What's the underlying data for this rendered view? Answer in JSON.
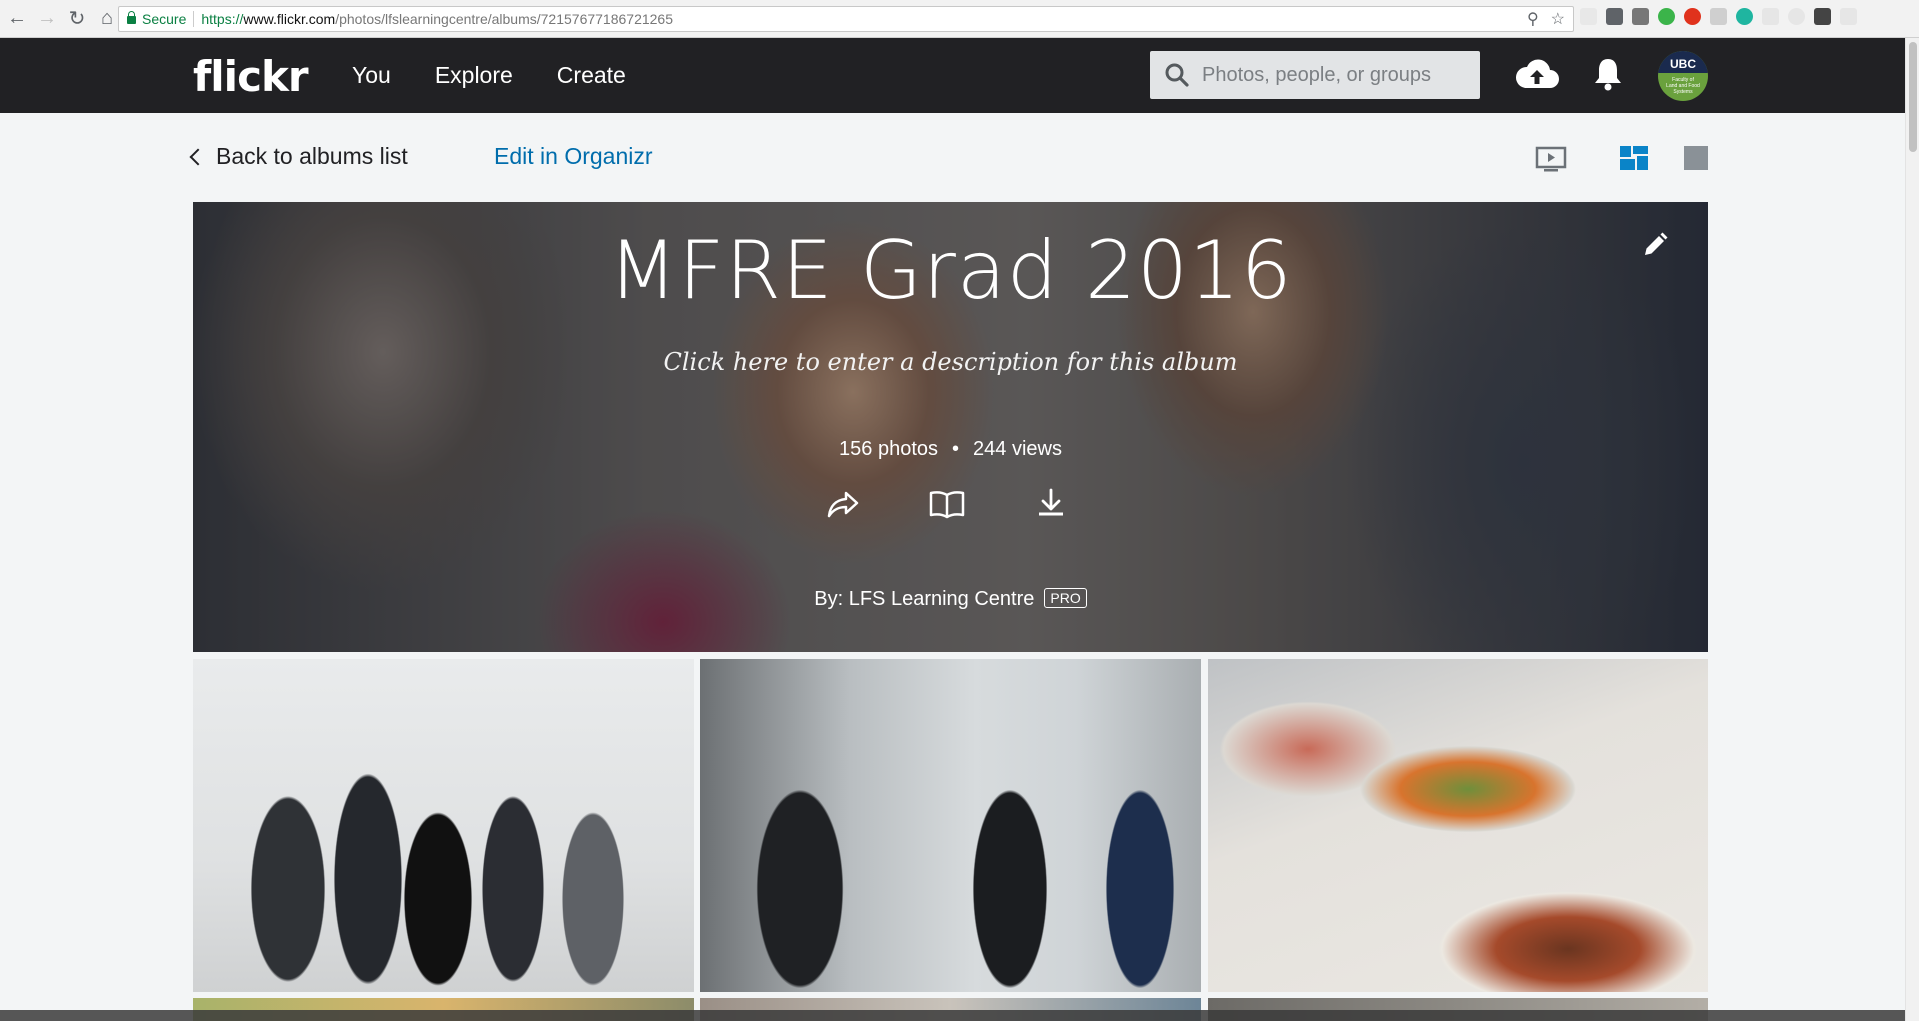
{
  "browser": {
    "secure_label": "Secure",
    "url_scheme": "https://",
    "url_host": "www.flickr.com",
    "url_path": "/photos/lfslearningcentre/albums/72157677186721265"
  },
  "header": {
    "logo": "flickr",
    "nav": [
      "You",
      "Explore",
      "Create"
    ],
    "search_placeholder": "Photos, people, or groups",
    "avatar_text": "UBC",
    "avatar_subtext": "Faculty of Land and Food Systems"
  },
  "subnav": {
    "back_label": "Back to albums list",
    "edit_label": "Edit in Organizr"
  },
  "album": {
    "title": "MFRE Grad 2016",
    "description_placeholder": "Click here to enter a description for this album",
    "photos": "156 photos",
    "views": "244 views",
    "separator": "•",
    "owner": "By: LFS Learning Centre",
    "badge": "PRO"
  },
  "colors": {
    "header_bg": "#212124",
    "link_blue": "#006dac",
    "active_view": "#0a84c8",
    "page_bg": "#f3f5f6"
  },
  "icons": {
    "share": "share-icon",
    "book": "book-icon",
    "download": "download-icon",
    "pencil": "pencil-icon",
    "upload": "upload-cloud-icon",
    "bell": "bell-icon",
    "search": "search-icon"
  }
}
